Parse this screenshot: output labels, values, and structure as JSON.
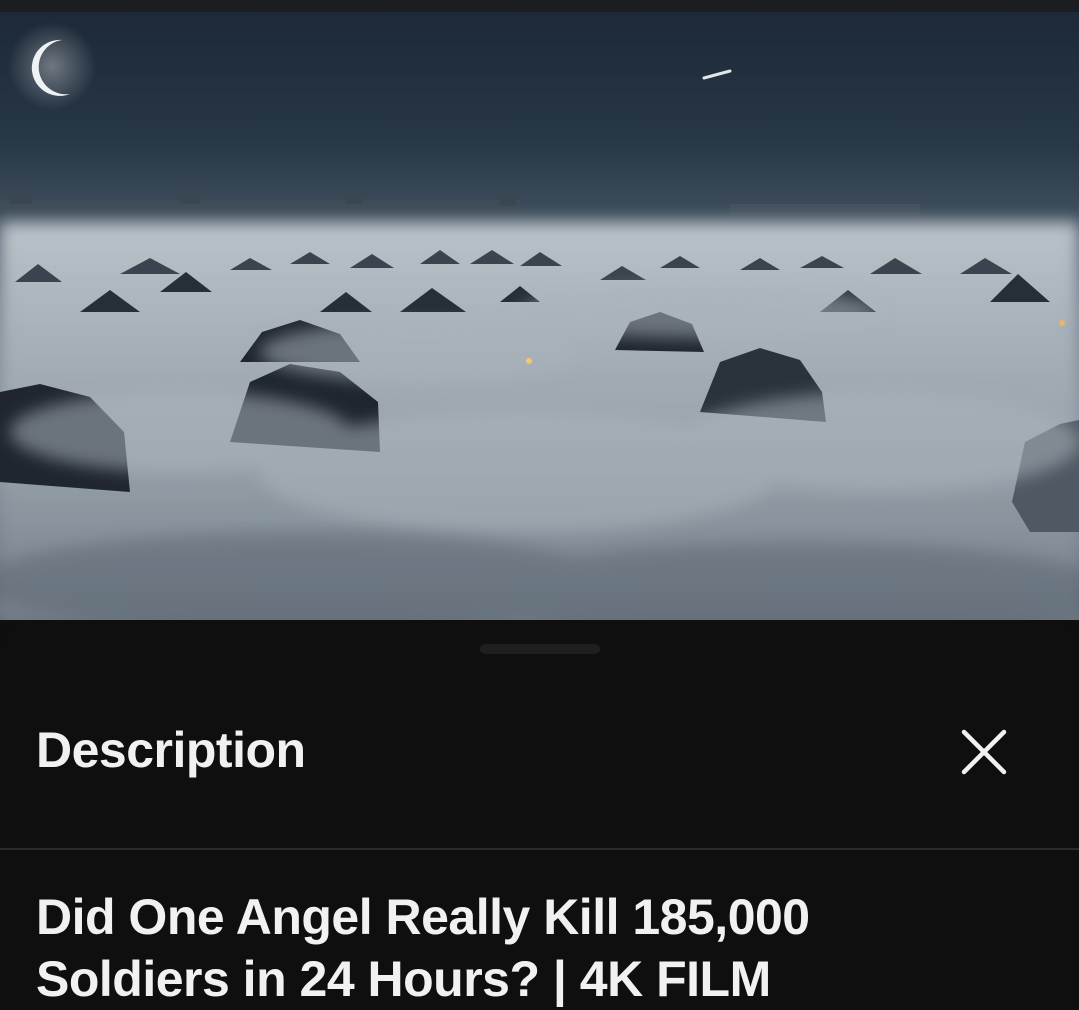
{
  "description_panel": {
    "header": "Description",
    "close_icon": "close-icon",
    "video_title_lines": [
      "Did One Angel Really Kill 185,000",
      "Soldiers in 24 Hours? | 4K FILM"
    ]
  },
  "colors": {
    "background": "#0f0f0f",
    "text": "#f1f1f1",
    "divider": "#2a2a2a"
  }
}
